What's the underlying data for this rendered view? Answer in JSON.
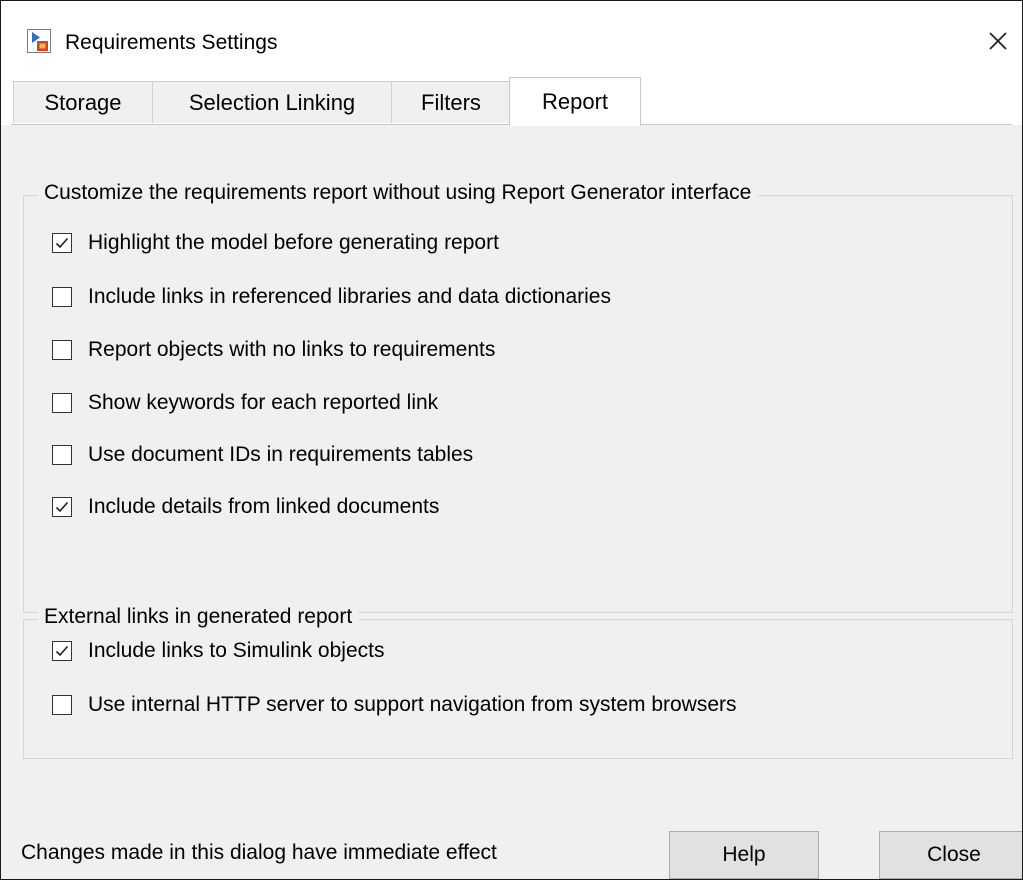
{
  "window": {
    "title": "Requirements Settings",
    "app_icon": "simulink-requirements-icon",
    "close_icon": "close-icon"
  },
  "tabs": [
    {
      "label": "Storage",
      "active": false
    },
    {
      "label": "Selection Linking",
      "active": false
    },
    {
      "label": "Filters",
      "active": false
    },
    {
      "label": "Report",
      "active": true
    }
  ],
  "report_group": {
    "title": "Customize the requirements report without using Report Generator interface",
    "options": [
      {
        "label": "Highlight the model before generating report",
        "checked": true
      },
      {
        "label": "Include links in referenced libraries and data dictionaries",
        "checked": false
      },
      {
        "label": "Report objects with no links to requirements",
        "checked": false
      },
      {
        "label": "Show keywords for each reported link",
        "checked": false
      },
      {
        "label": "Use document IDs in requirements tables",
        "checked": false
      },
      {
        "label": "Include details from linked documents",
        "checked": true
      }
    ]
  },
  "external_group": {
    "title": "External links in generated report",
    "options": [
      {
        "label": "Include links to Simulink objects",
        "checked": true
      },
      {
        "label": "Use internal HTTP server to support navigation from system browsers",
        "checked": false
      }
    ]
  },
  "footer": {
    "message": "Changes made in this dialog have immediate effect",
    "help_label": "Help",
    "close_label": "Close"
  }
}
